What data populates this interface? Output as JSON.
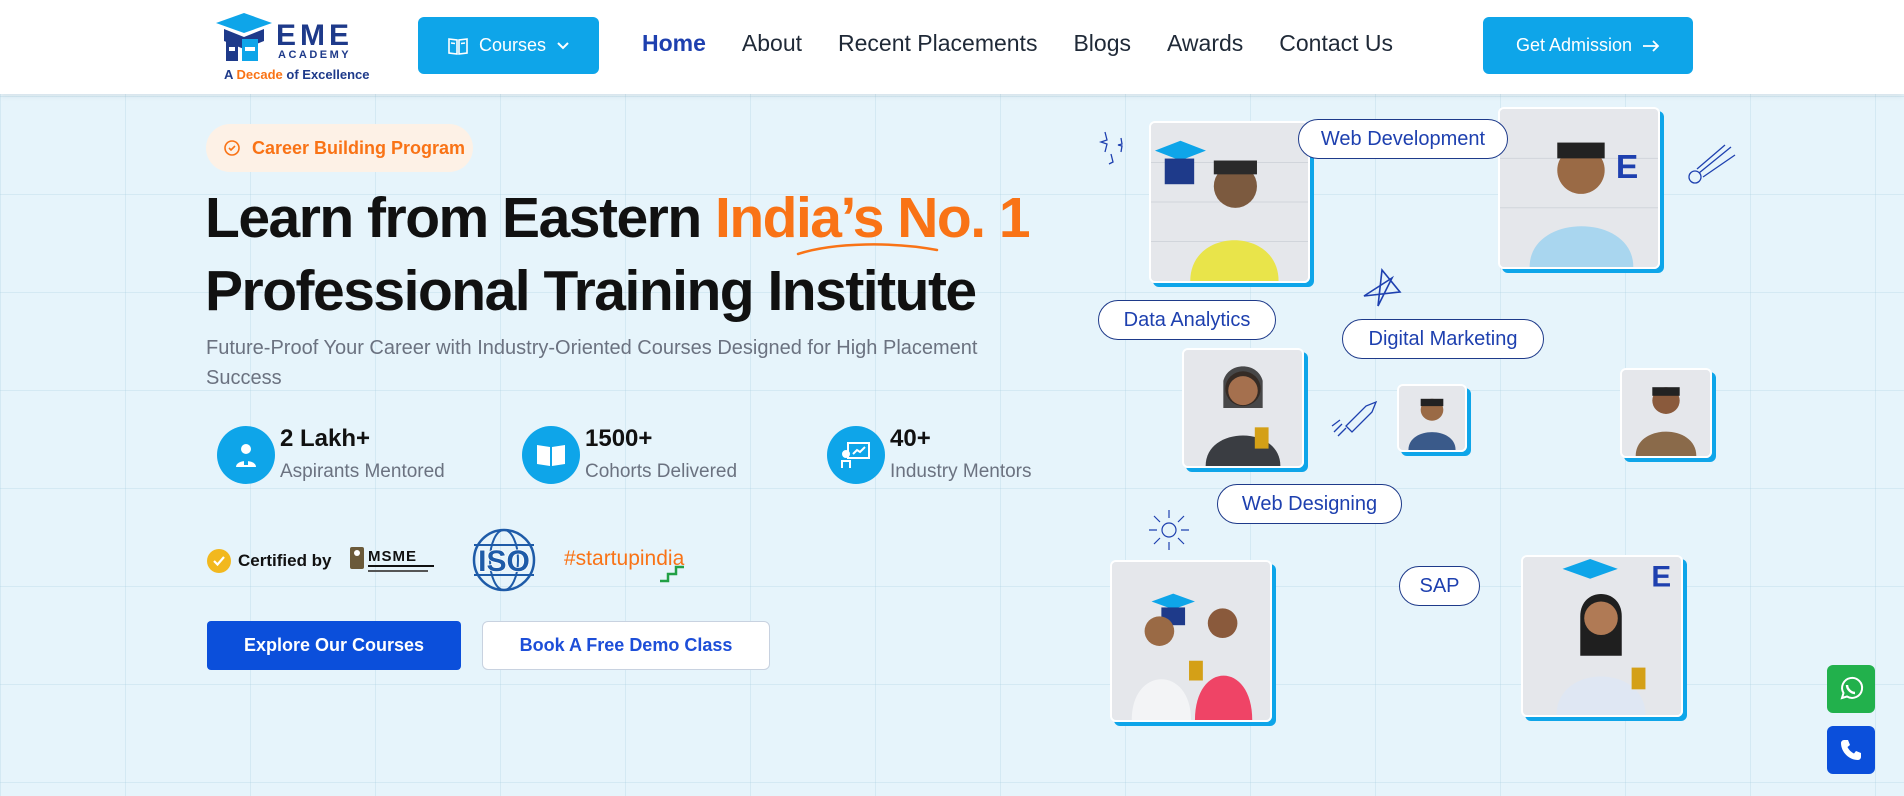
{
  "header": {
    "logo": {
      "brand": "EME",
      "sub": "ACADEMY",
      "tagline_prefix": "A ",
      "tagline_highlight": "Decade",
      "tagline_suffix": " of Excellence"
    },
    "courses_label": "Courses",
    "nav": [
      {
        "label": "Home",
        "active": true
      },
      {
        "label": "About"
      },
      {
        "label": "Recent Placements"
      },
      {
        "label": "Blogs"
      },
      {
        "label": "Awards"
      },
      {
        "label": "Contact Us"
      }
    ],
    "cta_label": "Get Admission"
  },
  "hero": {
    "badge": "Career Building Program",
    "title_line1_plain": "Learn from Eastern ",
    "title_line1_highlight": "India’s No. 1",
    "title_line2": "Professional Training Institute",
    "subtitle": "Future-Proof Your Career with Industry-Oriented Courses Designed for High Placement Success",
    "stats": [
      {
        "value": "2 Lakh+",
        "label": "Aspirants Mentored",
        "icon": "mentor-icon"
      },
      {
        "value": "1500+",
        "label": "Cohorts Delivered",
        "icon": "book-icon"
      },
      {
        "value": "40+",
        "label": "Industry Mentors",
        "icon": "presentation-icon"
      }
    ],
    "certified_label": "Certified by",
    "cert_logos": [
      "MSME",
      "ISO",
      "#startupindia"
    ],
    "explore_label": "Explore Our Courses",
    "demo_label": "Book A Free Demo Class"
  },
  "collage": {
    "tags": [
      "Web Development",
      "Data Analytics",
      "Digital Marketing",
      "Web Designing",
      "SAP"
    ]
  },
  "colors": {
    "accent": "#0ea5e9",
    "orange": "#f97316",
    "navy": "#1e3a8a",
    "primary_button": "#0b4fdb",
    "whatsapp": "#22b14c"
  }
}
